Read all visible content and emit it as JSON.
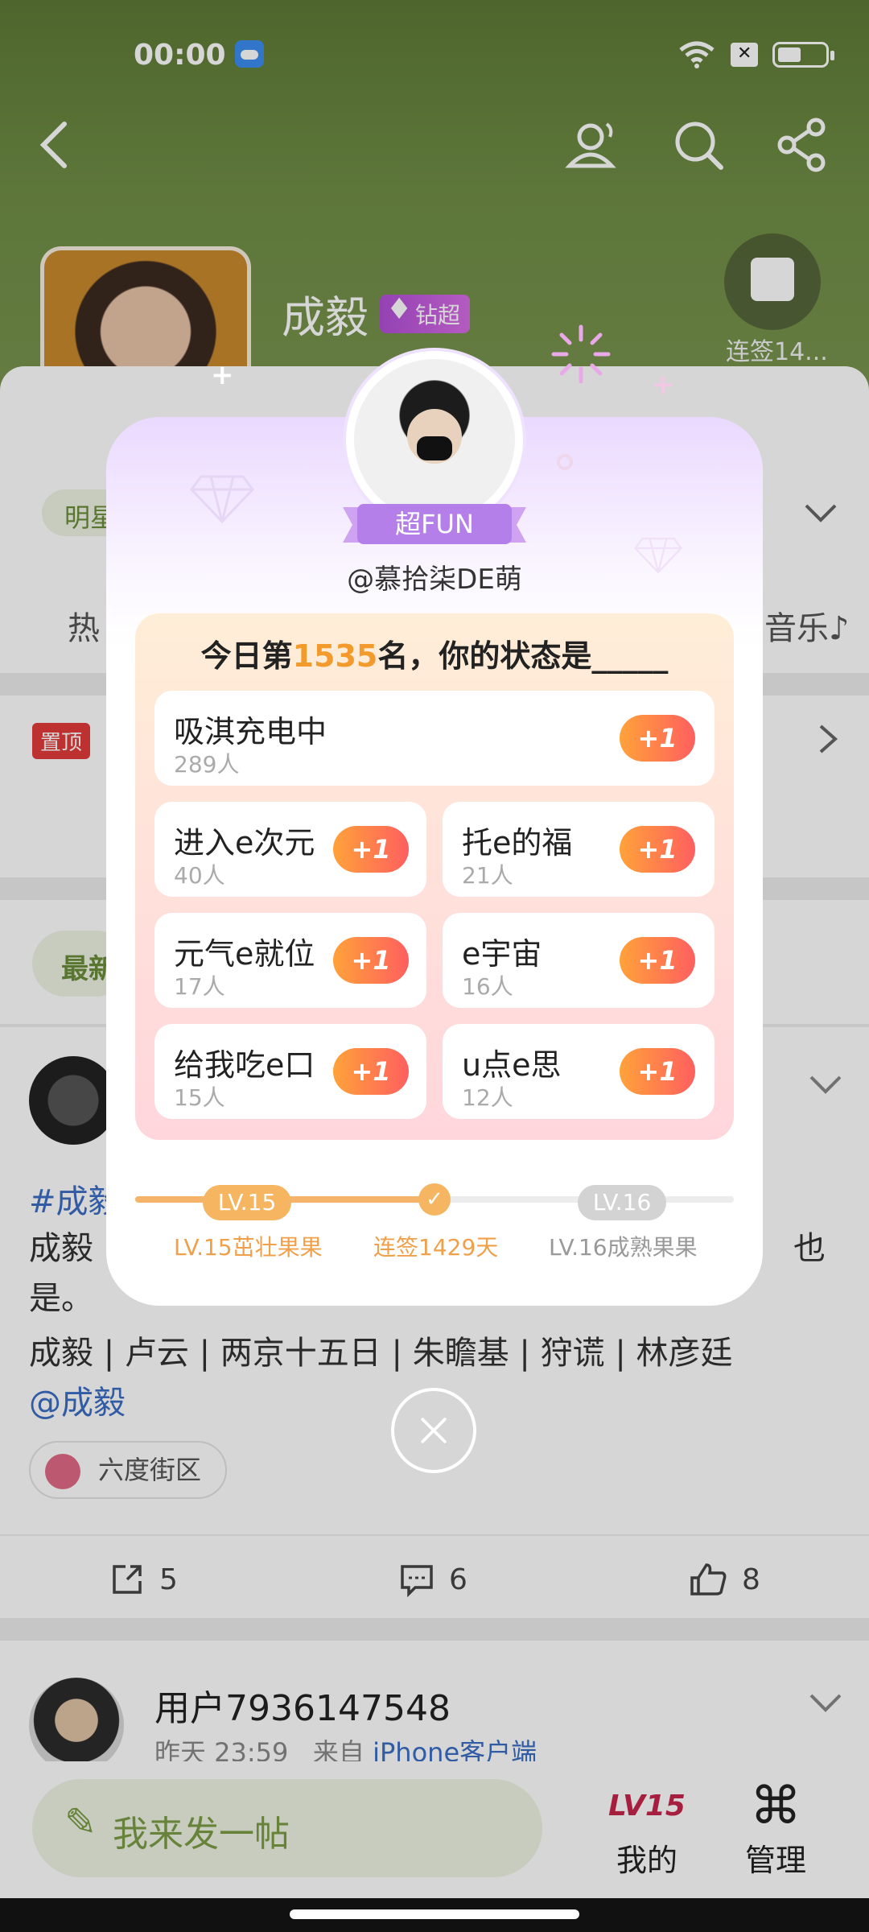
{
  "status_bar": {
    "time": "00:00"
  },
  "header": {
    "name": "成毅",
    "badge": "钻超",
    "checkin_label": "连签14...",
    "chip_star": "明星",
    "tab_hot": "热",
    "tab_music": "音乐♪"
  },
  "pinned": {
    "tag": "置顶"
  },
  "feed": {
    "chip_new": "最新",
    "post": {
      "hashtag": "#成毅",
      "text_line1": "成毅",
      "text_line1_end": "也",
      "text_line2": "是。",
      "text_line3": "成毅 | 卢云 | 两京十五日 | 朱瞻基 | 狩谎 | 林彦廷",
      "mention": "@成毅",
      "location": "六度街区",
      "shares": "5",
      "comments": "6",
      "likes": "8"
    },
    "next_user": {
      "name": "用户7936147548",
      "time": "昨天 23:59",
      "from_prefix": "来自",
      "source": "iPhone客户端"
    }
  },
  "bottom_nav": {
    "compose_placeholder": "我来发一帖",
    "mine_icon_text": "LV15",
    "mine_label": "我的",
    "manage_label": "管理"
  },
  "modal": {
    "fun_badge": "超FUN",
    "username": "@慕拾柒DE萌",
    "rank_prefix": "今日第",
    "rank_number": "1535",
    "rank_suffix": "名，你的状态是_____",
    "plus_label": "+1",
    "options": [
      {
        "name": "吸淇充电中",
        "count": "289人"
      },
      {
        "name": "进入e次元",
        "count": "40人"
      },
      {
        "name": "托e的福",
        "count": "21人"
      },
      {
        "name": "元气e就位",
        "count": "17人"
      },
      {
        "name": "e宇宙",
        "count": "16人"
      },
      {
        "name": "给我吃e口",
        "count": "15人"
      },
      {
        "name": "u点e思",
        "count": "12人"
      }
    ],
    "level": {
      "current_pill": "LV.15",
      "next_pill": "LV.16",
      "current_label": "LV.15茁壮果果",
      "streak_label": "连签1429天",
      "next_label": "LV.16成熟果果",
      "progress_fraction": 0.52
    }
  },
  "colors": {
    "accent_orange": "#f39a2c",
    "plus_gradient_start": "#ffa23a",
    "plus_gradient_end": "#ff5f5f",
    "brand_green": "#7a9c44"
  }
}
